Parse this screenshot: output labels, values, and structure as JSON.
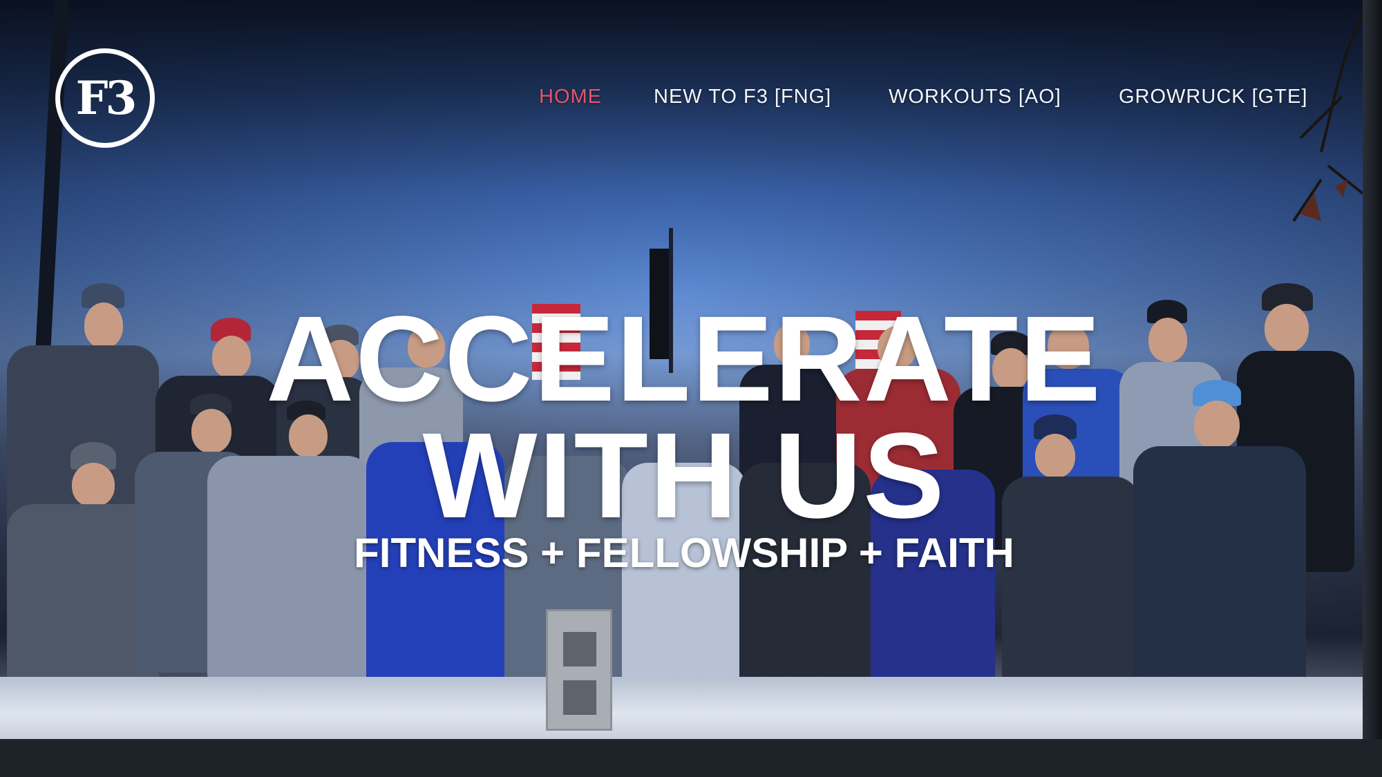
{
  "site": {
    "logo_text": "F3"
  },
  "nav": {
    "items": [
      {
        "label": "HOME",
        "active": true
      },
      {
        "label": "NEW TO F3 [FNG]",
        "active": false
      },
      {
        "label": "WORKOUTS [AO]",
        "active": false
      },
      {
        "label": "GROWRUCK [GTE]",
        "active": false
      }
    ],
    "active_color": "#e4546a",
    "text_color": "#f4f6fa"
  },
  "hero": {
    "headline_line1": "ACCELERATE",
    "headline_line2": "WITH US",
    "tagline": "FITNESS + FELLOWSHIP + FAITH",
    "image_description_icon": "group-photo-image"
  }
}
